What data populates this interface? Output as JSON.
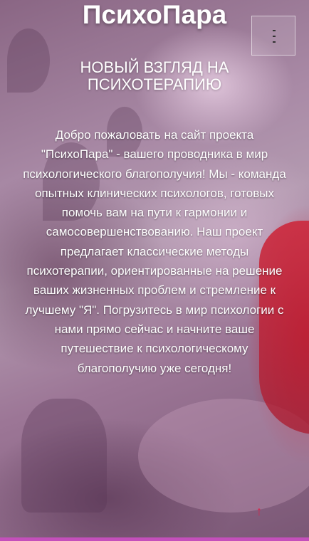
{
  "header": {
    "title": "ПсихоПара",
    "menu_icon": "menu-icon"
  },
  "hero": {
    "tagline": "НОВЫЙ ВЗГЛЯД НА ПСИХОТЕРАПИЮ",
    "intro": "Добро пожаловать на сайт проекта \"ПсихоПара\" - вашего проводника в мир психологического благополучия! Мы - команда опытных клинических психологов, готовых помочь вам на пути к гармонии и самосовершенствованию. Наш проект предлагает классические методы психотерапии, ориентированные на решение ваших жизненных проблем и стремление к лучшему \"Я\". Погрузитесь в мир психологии с нами прямо сейчас и начните ваше путешествие к психологическому благополучию уже сегодня!"
  },
  "scroll_top": {
    "icon": "arrow-up-icon",
    "glyph": "↑"
  },
  "colors": {
    "accent_bar": "#c44fbb",
    "scroll_arrow": "#d9254d",
    "text": "#ffffff"
  }
}
